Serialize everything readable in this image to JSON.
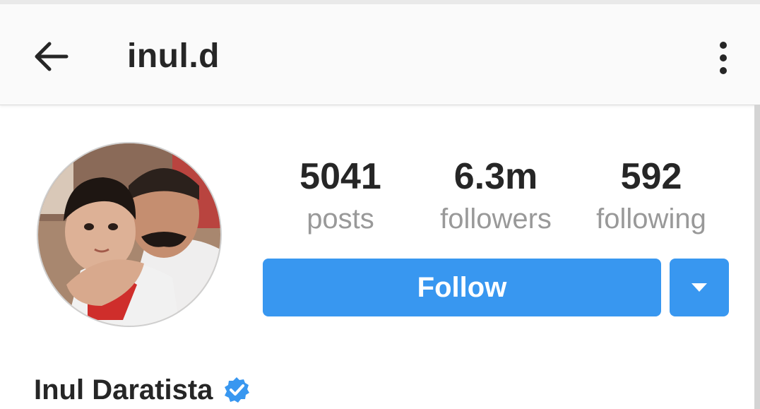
{
  "header": {
    "username": "inul.d",
    "back_icon": "arrow-left-icon",
    "more_icon": "more-vertical-icon"
  },
  "profile": {
    "avatar_icon": "profile-photo",
    "stats": [
      {
        "value": "5041",
        "label": "posts"
      },
      {
        "value": "6.3m",
        "label": "followers"
      },
      {
        "value": "592",
        "label": "following"
      }
    ],
    "follow_label": "Follow",
    "dropdown_icon": "caret-down-icon",
    "full_name": "Inul Daratista",
    "verified_icon": "verified-badge-icon"
  },
  "colors": {
    "accent": "#3897f0",
    "text": "#262626",
    "muted": "#999999",
    "header_bg": "#fafafa"
  }
}
